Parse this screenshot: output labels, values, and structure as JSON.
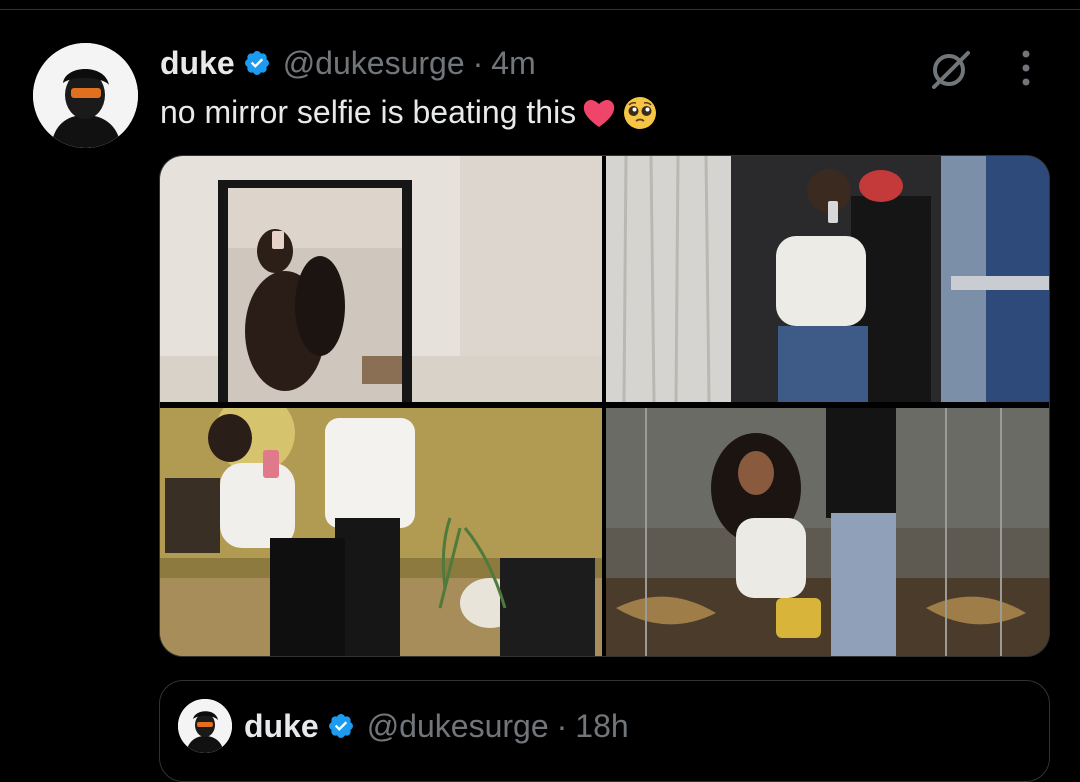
{
  "tweet": {
    "display_name": "duke",
    "handle": "@dukesurge",
    "separator": "·",
    "time": "4m",
    "text": "no mirror selfie is beating this",
    "emojis": [
      "heart-emoji",
      "pleading-face-emoji"
    ]
  },
  "media": {
    "photos": [
      {
        "name": "mirror-selfie-photo-1"
      },
      {
        "name": "mirror-selfie-photo-2"
      },
      {
        "name": "mirror-selfie-photo-3"
      },
      {
        "name": "mirror-selfie-photo-4"
      }
    ]
  },
  "quoted_tweet": {
    "display_name": "duke",
    "handle": "@dukesurge",
    "separator": "·",
    "time": "18h"
  },
  "icons": [
    "verified-badge-icon",
    "grok-icon",
    "more-icon"
  ],
  "colors": {
    "background": "#000000",
    "text_primary": "#e7e9ea",
    "text_secondary": "#71767b",
    "verified_blue": "#1d9bf0",
    "border": "#2f3336"
  }
}
